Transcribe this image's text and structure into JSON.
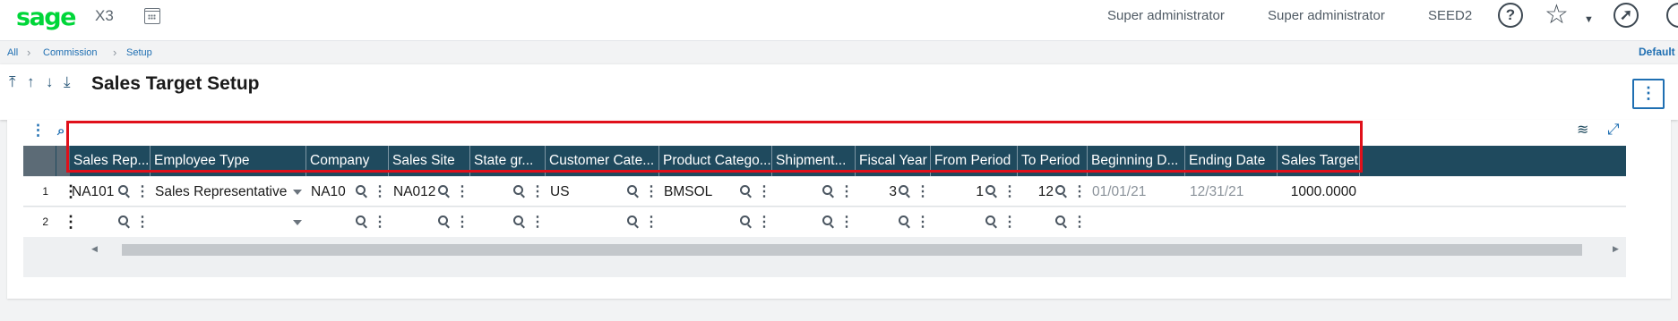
{
  "topbar": {
    "logo": "sage",
    "app_name": "X3",
    "calendar_icon": "calendar-icon",
    "user_role": "Super administrator",
    "user_name": "Super administrator",
    "folder": "SEED2",
    "icons": [
      "help-icon",
      "star-icon",
      "chevron-down-icon",
      "compass-icon",
      "search-icon"
    ]
  },
  "breadcrumb": {
    "items": [
      "All",
      "Commission",
      "Setup"
    ],
    "default_label": "Default"
  },
  "header": {
    "title": "Sales Target Setup",
    "nav_icons": [
      "first-record-icon",
      "previous-record-icon",
      "next-record-icon",
      "last-record-icon"
    ],
    "actions_icon": "more-vertical-icon"
  },
  "grid": {
    "toolbar_icons": [
      "more-vertical-icon",
      "search-icon",
      "layers-icon",
      "expand-icon"
    ],
    "columns": [
      "Sales Rep...",
      "Employee Type",
      "Company",
      "Sales Site",
      "State gr...",
      "Customer Cate...",
      "Product Catego...",
      "Shipment...",
      "Fiscal Year",
      "From Period",
      "To Period",
      "Beginning D...",
      "Ending Date",
      "Sales Target"
    ],
    "rows": [
      {
        "num": "1",
        "values": [
          "NA101",
          "Sales Representative",
          "NA10",
          "NA012",
          "",
          "US",
          "BMSOL",
          "",
          "3",
          "1",
          "12",
          "01/01/21",
          "12/31/21",
          "1000.0000"
        ]
      },
      {
        "num": "2",
        "values": [
          "",
          "",
          "",
          "",
          "",
          "",
          "",
          "",
          "",
          "",
          "",
          "",
          "",
          ""
        ]
      }
    ]
  },
  "colors": {
    "brand": "#00d639",
    "header_bg": "#1f4a5e",
    "link": "#1f6fb2",
    "highlight": "#e0101a"
  }
}
